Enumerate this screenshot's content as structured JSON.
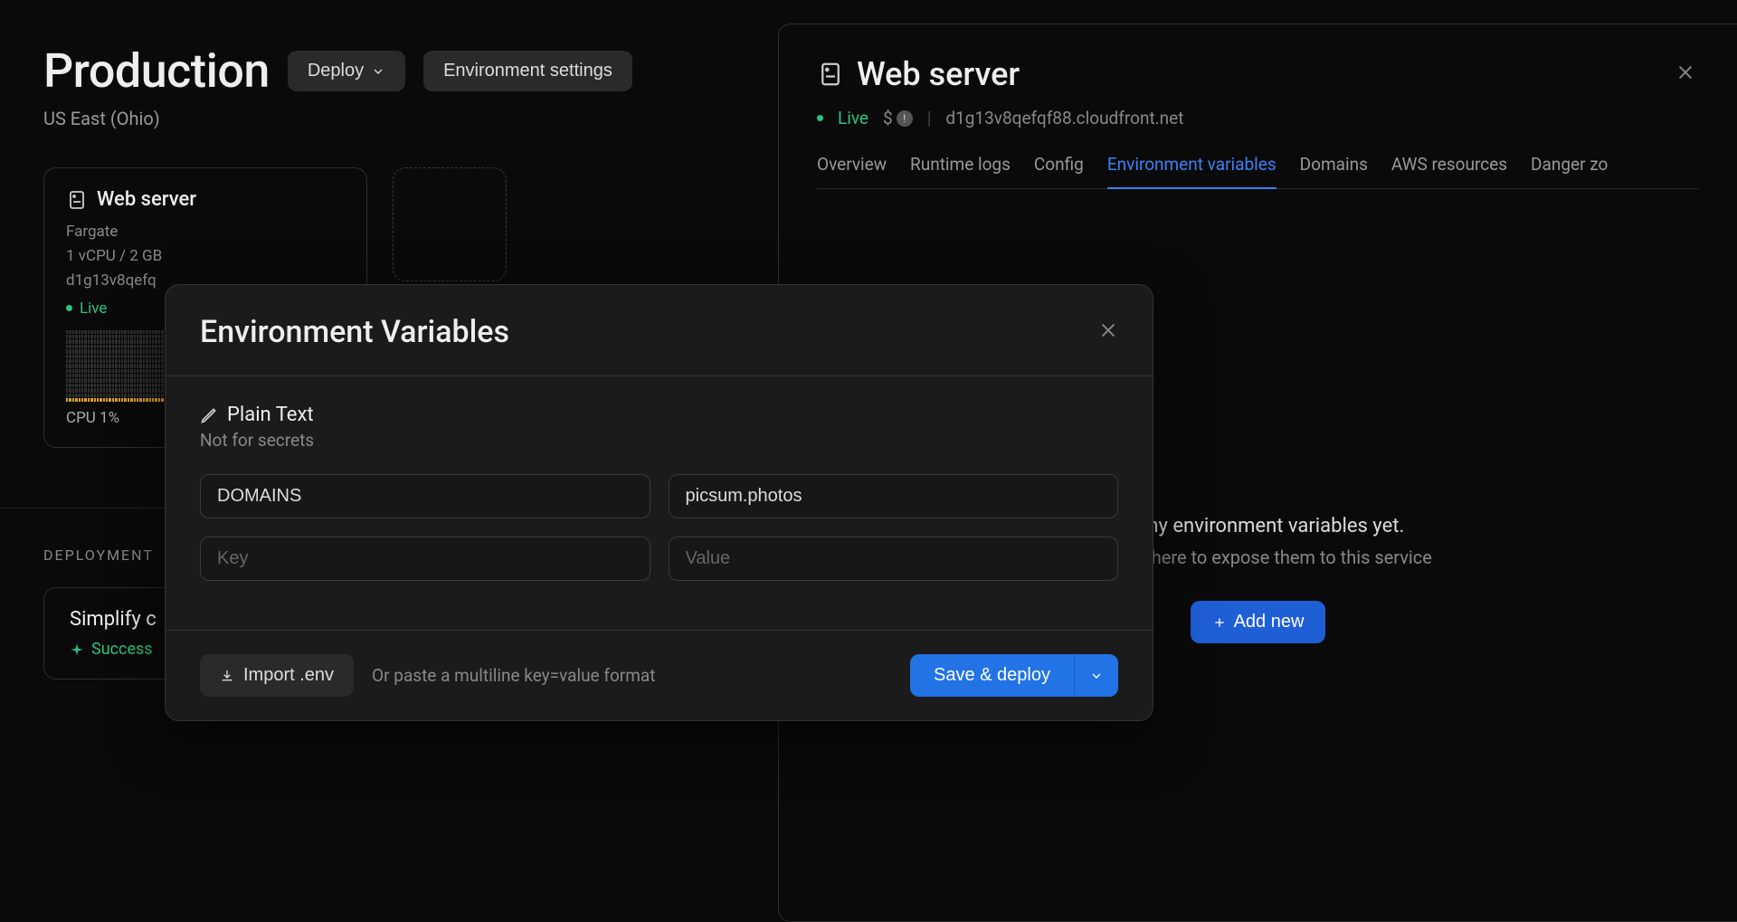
{
  "page": {
    "title": "Production",
    "region": "US East (Ohio)",
    "deploy_button": "Deploy",
    "settings_button": "Environment settings"
  },
  "server_card": {
    "title": "Web server",
    "engine": "Fargate",
    "spec": "1 vCPU / 2 GB",
    "url_truncated": "d1g13v8qefq",
    "status": "Live",
    "cpu_label": "CPU 1%"
  },
  "deployments": {
    "section_label": "DEPLOYMENT",
    "title_truncated": "Simplify c",
    "status": "Success"
  },
  "panel": {
    "title": "Web server",
    "status": "Live",
    "cost_symbol": "$",
    "url": "d1g13v8qefqf88.cloudfront.net",
    "tabs": [
      "Overview",
      "Runtime logs",
      "Config",
      "Environment variables",
      "Domains",
      "AWS resources",
      "Danger zo"
    ],
    "active_tab_index": 3
  },
  "empty": {
    "title_partial": "ve any environment variables yet.",
    "subtitle_partial": "variable here to expose them to this service",
    "add_button": "Add new"
  },
  "modal": {
    "title": "Environment Variables",
    "section_title": "Plain Text",
    "section_subtitle": "Not for secrets",
    "key1": "DOMAINS",
    "value1": "picsum.photos",
    "key_placeholder": "Key",
    "value_placeholder": "Value",
    "import_button": "Import .env",
    "hint": "Or paste a multiline key=value format",
    "save_button": "Save & deploy"
  }
}
